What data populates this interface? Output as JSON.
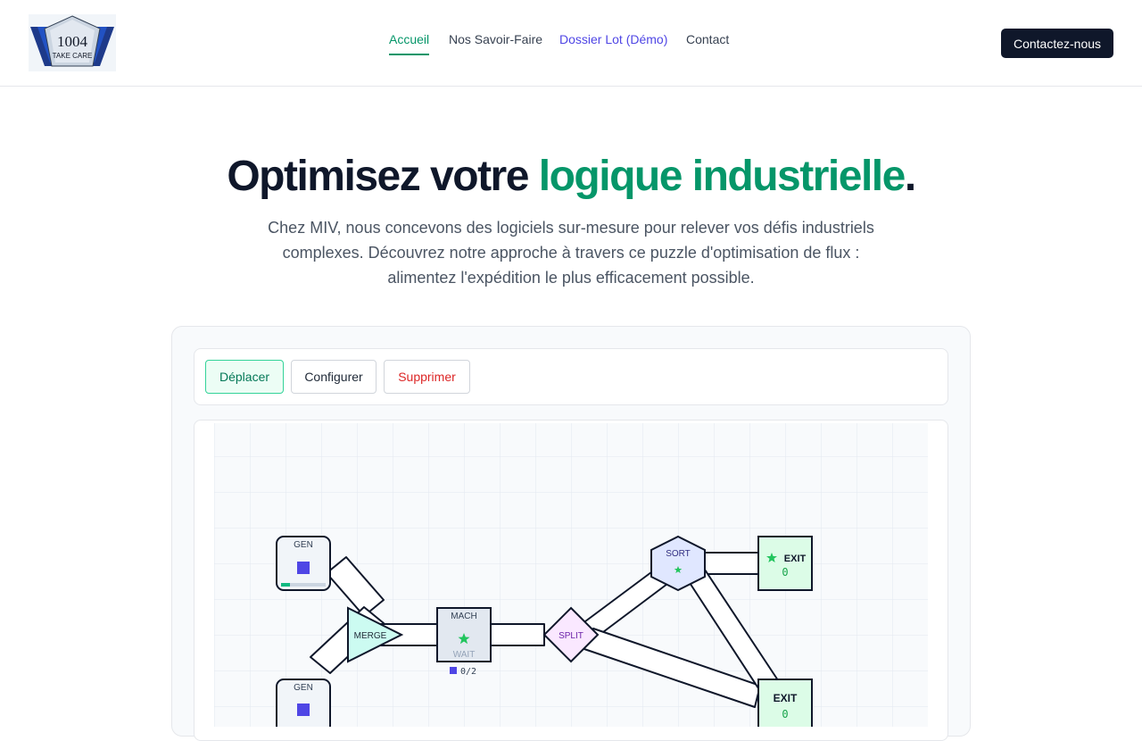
{
  "logo": {
    "line1": "1004",
    "line2": "TAKE CARE"
  },
  "nav": {
    "items": [
      {
        "label": "Accueil",
        "active": true
      },
      {
        "label": "Nos Savoir-Faire"
      },
      {
        "label": "Dossier Lot (Démo)"
      },
      {
        "label": "Contact"
      }
    ],
    "cta": "Contactez-nous"
  },
  "hero": {
    "title_start": "Optimisez votre ",
    "title_accent": "logique industrielle",
    "title_end": ".",
    "subtitle": "Chez MIV, nous concevons des logiciels sur-mesure pour relever vos défis industriels complexes. Découvrez notre approche à travers ce puzzle d'optimisation de flux : alimentez l'expédition le plus efficacement possible."
  },
  "tools": {
    "move": "Déplacer",
    "configure": "Configurer",
    "delete": "Supprimer"
  },
  "board": {
    "gen1": "GEN",
    "gen2": "GEN",
    "merge": "MERGE",
    "machine": "MACH",
    "machine_status": "WAIT",
    "machine_counter": "0/2",
    "split": "SPLIT",
    "sort": "SORT",
    "exit1": "EXIT",
    "exit1_count": "0",
    "exit2": "EXIT",
    "exit2_count": "0",
    "colors": {
      "item": "#4f46e5",
      "star": "#22c55e",
      "line": "#0f172a",
      "grid": "#e2e8f0"
    }
  }
}
